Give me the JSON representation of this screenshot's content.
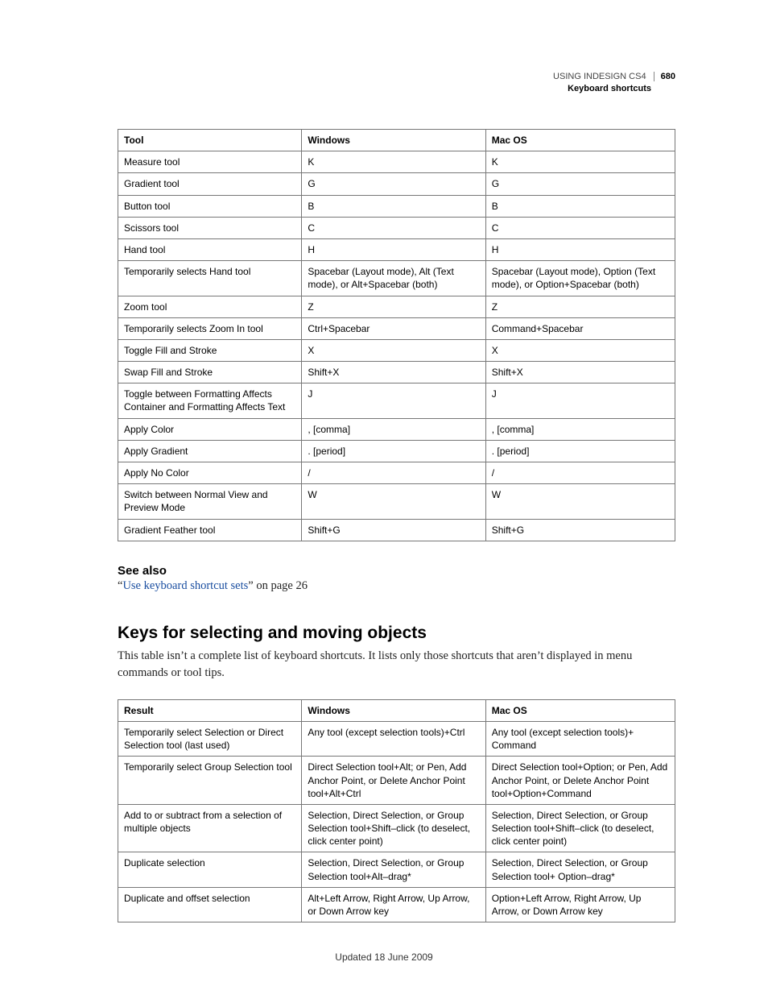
{
  "header": {
    "doc_title": "USING INDESIGN CS4",
    "page_number": "680",
    "section": "Keyboard shortcuts"
  },
  "table1": {
    "head": {
      "c1": "Tool",
      "c2": "Windows",
      "c3": "Mac OS"
    },
    "rows": [
      {
        "c1": "Measure tool",
        "c2": "K",
        "c3": "K"
      },
      {
        "c1": "Gradient tool",
        "c2": "G",
        "c3": "G"
      },
      {
        "c1": "Button tool",
        "c2": "B",
        "c3": "B"
      },
      {
        "c1": "Scissors tool",
        "c2": "C",
        "c3": "C"
      },
      {
        "c1": "Hand tool",
        "c2": "H",
        "c3": "H"
      },
      {
        "c1": "Temporarily selects Hand tool",
        "c2": "Spacebar (Layout mode), Alt (Text mode), or Alt+Spacebar (both)",
        "c3": "Spacebar (Layout mode), Option (Text mode), or Option+Spacebar (both)"
      },
      {
        "c1": "Zoom tool",
        "c2": "Z",
        "c3": "Z"
      },
      {
        "c1": "Temporarily selects Zoom In tool",
        "c2": "Ctrl+Spacebar",
        "c3": "Command+Spacebar"
      },
      {
        "c1": "Toggle Fill and Stroke",
        "c2": "X",
        "c3": "X"
      },
      {
        "c1": "Swap Fill and Stroke",
        "c2": "Shift+X",
        "c3": "Shift+X"
      },
      {
        "c1": "Toggle between Formatting Affects Container and Formatting Affects Text",
        "c2": "J",
        "c3": "J"
      },
      {
        "c1": "Apply Color",
        "c2": ", [comma]",
        "c3": ", [comma]"
      },
      {
        "c1": "Apply Gradient",
        "c2": ". [period]",
        "c3": ". [period]"
      },
      {
        "c1": "Apply No Color",
        "c2": "/",
        "c3": "/"
      },
      {
        "c1": "Switch between Normal View and Preview Mode",
        "c2": "W",
        "c3": "W"
      },
      {
        "c1": "Gradient Feather tool",
        "c2": "Shift+G",
        "c3": "Shift+G"
      }
    ]
  },
  "see_also": {
    "heading": "See also",
    "quote_open": "“",
    "link_text": "Use keyboard shortcut sets",
    "suffix": "” on page 26"
  },
  "section2": {
    "heading": "Keys for selecting and moving objects",
    "intro": "This table isn’t a complete list of keyboard shortcuts. It lists only those shortcuts that aren’t displayed in menu commands or tool tips."
  },
  "table2": {
    "head": {
      "c1": "Result",
      "c2": "Windows",
      "c3": "Mac OS"
    },
    "rows": [
      {
        "c1": "Temporarily select Selection or Direct Selection tool (last used)",
        "c2": "Any tool (except selection tools)+Ctrl",
        "c3": "Any tool (except selection tools)+ Command"
      },
      {
        "c1": "Temporarily select Group Selection tool",
        "c2": "Direct Selection tool+Alt; or Pen, Add Anchor Point, or Delete Anchor Point tool+Alt+Ctrl",
        "c3": "Direct Selection tool+Option; or Pen, Add Anchor Point, or Delete Anchor Point tool+Option+Command"
      },
      {
        "c1": "Add to or subtract from a selection of multiple objects",
        "c2": "Selection, Direct Selection, or Group Selection tool+Shift–click (to deselect, click center point)",
        "c3": "Selection, Direct Selection, or Group Selection tool+Shift–click (to deselect, click center point)"
      },
      {
        "c1": "Duplicate selection",
        "c2": "Selection, Direct Selection, or Group Selection tool+Alt–drag*",
        "c3": "Selection, Direct Selection, or Group Selection tool+ Option–drag*"
      },
      {
        "c1": "Duplicate and offset selection",
        "c2": "Alt+Left Arrow, Right Arrow, Up Arrow, or Down Arrow key",
        "c3": "Option+Left Arrow, Right Arrow, Up Arrow, or Down Arrow key"
      }
    ]
  },
  "footer": {
    "updated": "Updated 18 June 2009"
  }
}
